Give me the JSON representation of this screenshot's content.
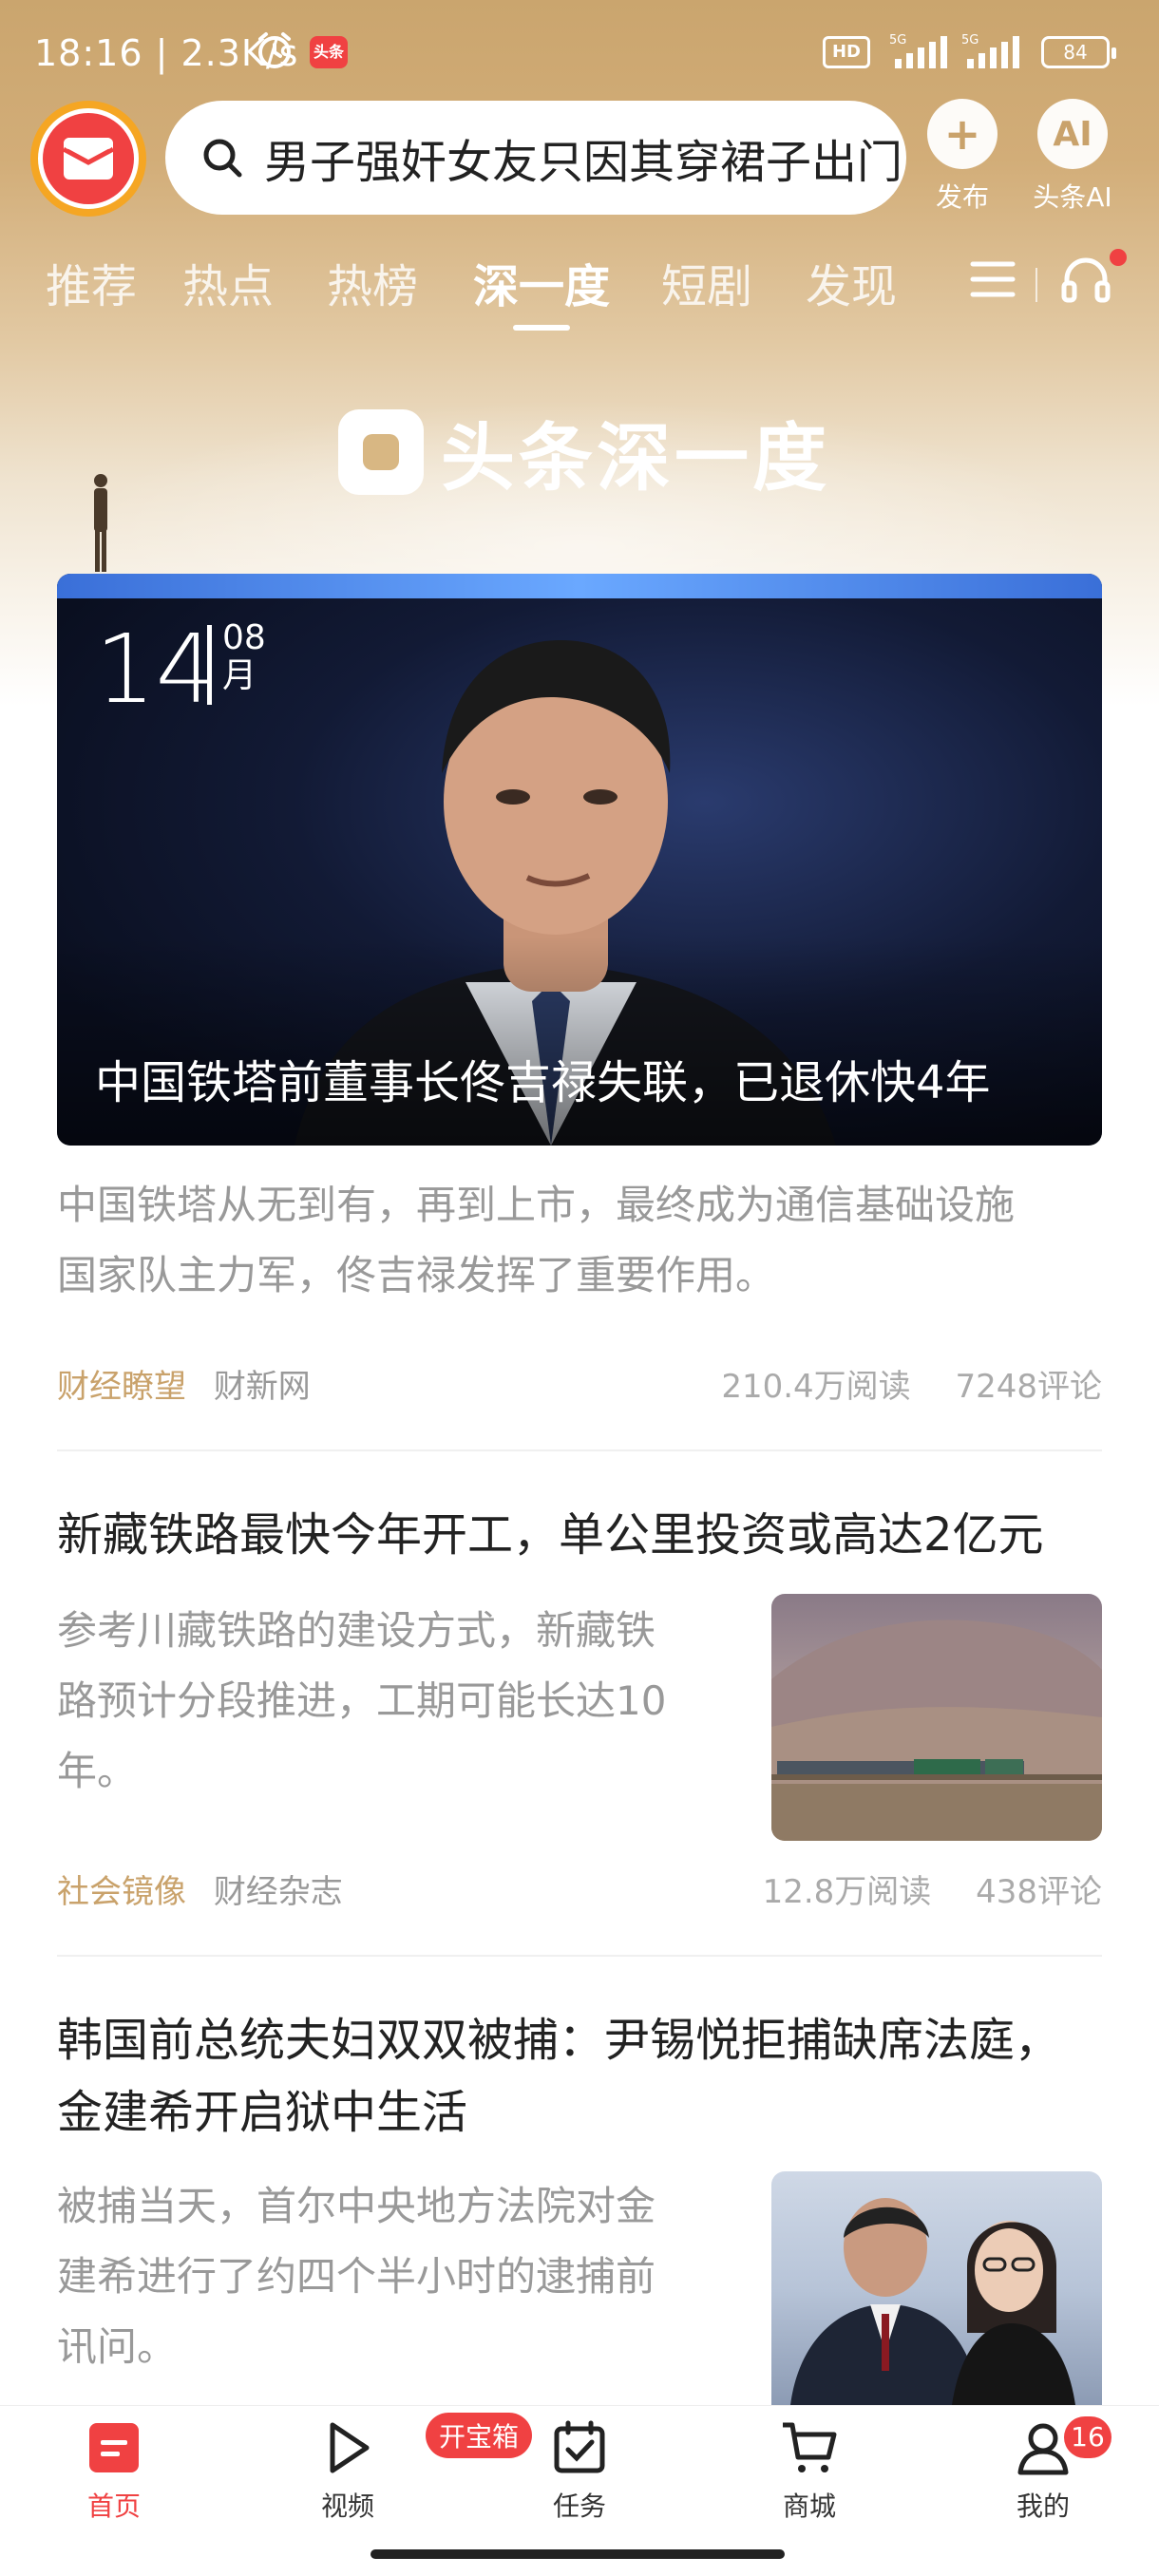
{
  "status_bar": {
    "time": "18:16 | 2.3K/s",
    "hd": "HD",
    "net1": "5G",
    "net2": "5G",
    "battery": "84"
  },
  "header": {
    "search_text": "男子强奸女友只因其穿裙子出门",
    "publish_label": "发布",
    "ai_label": "头条AI",
    "ai_glyph": "AI"
  },
  "tabs": [
    "推荐",
    "热点",
    "热榜",
    "深一度",
    "短剧",
    "发现"
  ],
  "banner": {
    "title": "头条深一度"
  },
  "hero": {
    "day": "14",
    "month_num": "08",
    "month_char": "月",
    "caption": "中国铁塔前董事长佟吉禄失联，已退休快4年"
  },
  "articles": [
    {
      "title": "",
      "summary_lines": [
        "中国铁塔从无到有，再到上市，最终成为通信基础设施",
        "国家队主力军，佟吉禄发挥了重要作用。"
      ],
      "category": "财经瞭望",
      "source": "财新网",
      "reads": "210.4万阅读",
      "comments": "7248评论"
    },
    {
      "title_lines": [
        "新藏铁路最快今年开工，单公里投资或高达2亿元"
      ],
      "summary_lines": [
        "参考川藏铁路的建设方式，新藏铁",
        "路预计分段推进，工期可能长达10",
        "年。"
      ],
      "category": "社会镜像",
      "source": "财经杂志",
      "reads": "12.8万阅读",
      "comments": "438评论"
    },
    {
      "title_lines": [
        "韩国前总统夫妇双双被捕：尹锡悦拒捕缺席法庭，",
        "金建希开启狱中生活"
      ],
      "summary_lines": [
        "被捕当天，首尔中央地方法院对金",
        "建希进行了约四个半小时的逮捕前",
        "讯问。"
      ]
    }
  ],
  "bottom_nav": {
    "items": [
      "首页",
      "视频",
      "任务",
      "商城",
      "我的"
    ],
    "task_badge": "开宝箱",
    "mine_badge": "16"
  },
  "colors": {
    "brand_red": "#f04142",
    "gold": "#c9a26b"
  }
}
